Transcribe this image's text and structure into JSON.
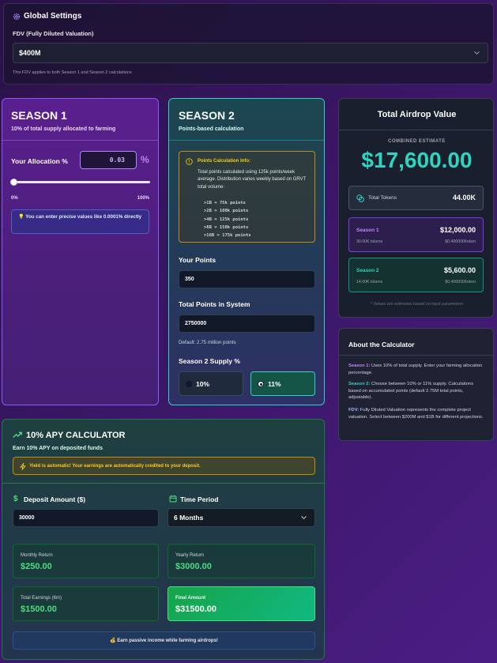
{
  "global": {
    "title": "Global Settings",
    "fdv_label": "FDV (Fully Diluted Valuation)",
    "fdv_value": "$400M",
    "fdv_hint": "This FDV applies to both Season 1 and Season 2 calculations"
  },
  "season1": {
    "title": "SEASON 1",
    "subtitle": "10% of total supply allocated to farming",
    "alloc_label": "Your Allocation %",
    "alloc_value": "0.03",
    "percent_sign": "%",
    "slider_min": "0%",
    "slider_max": "100%",
    "slider_fraction": 0.0003,
    "tip": "💡 You can enter precise values like 0.0001% directly"
  },
  "season2": {
    "title": "SEASON 2",
    "subtitle": "Points-based calculation",
    "info_title": "Points Calculation Info:",
    "info_text": "Total points calculated using 125k points/week average. Distribution varies weekly based on GRVT total volume:",
    "tiers": [
      ">1B = 75k points",
      ">2B = 100k points",
      ">4B = 125k points",
      ">8B = 150k points",
      ">16B = 175k points"
    ],
    "your_points_label": "Your Points",
    "your_points_value": "350",
    "total_points_label": "Total Points in System",
    "total_points_value": "2750000",
    "total_points_default": "Default: 2.75 million points",
    "supply_label": "Season 2 Supply %",
    "option_10": "10%",
    "option_11": "11%",
    "selected": "11%"
  },
  "airdrop": {
    "title": "Total Airdrop Value",
    "combined_label": "COMBINED ESTIMATE",
    "total_value": "$17,600.00",
    "tokens_label": "Total Tokens",
    "tokens_value": "44.00K",
    "s1_label": "Season 1",
    "s1_value": "$12,000.00",
    "s1_tokens": "30.00K tokens",
    "s1_price": "$0.400000/token",
    "s2_label": "Season 2",
    "s2_value": "$5,600.00",
    "s2_tokens": "14.00K tokens",
    "s2_price": "$0.400000/token",
    "note": "* Values are estimates based on input parameters"
  },
  "about": {
    "title": "About the Calculator",
    "s1_key": "Season 1:",
    "s1_text": " Uses 10% of total supply. Enter your farming allocation percentage.",
    "s2_key": "Season 2:",
    "s2_text": " Choose between 10% or 11% supply. Calculations based on accumulated points (default 2.75M total points, adjustable).",
    "fdv_key": "FDV:",
    "fdv_text": " Fully Diluted Valuation represents the complete project valuation. Select between $200M and $1B for different projections."
  },
  "apy": {
    "title": "10% APY CALCULATOR",
    "subtitle": "Earn 10% APY on deposited funds",
    "auto_note": "Yield is automatic! Your earnings are automatically credited to your deposit.",
    "deposit_label": "Deposit Amount ($)",
    "deposit_value": "30000",
    "period_label": "Time Period",
    "period_value": "6 Months",
    "monthly_label": "Monthly Return",
    "monthly_value": "$250.00",
    "yearly_label": "Yearly Return",
    "yearly_value": "$3000.00",
    "earnings_label": "Total Earnings (6m)",
    "earnings_value": "$1500.00",
    "final_label": "Final Amount",
    "final_value": "$31500.00",
    "footer": "💰 Earn passive income while farming airdrops!"
  },
  "colors": {
    "purple": "#c084fc",
    "teal": "#2dd4bf",
    "green": "#4ade80",
    "amber": "#eab308"
  }
}
